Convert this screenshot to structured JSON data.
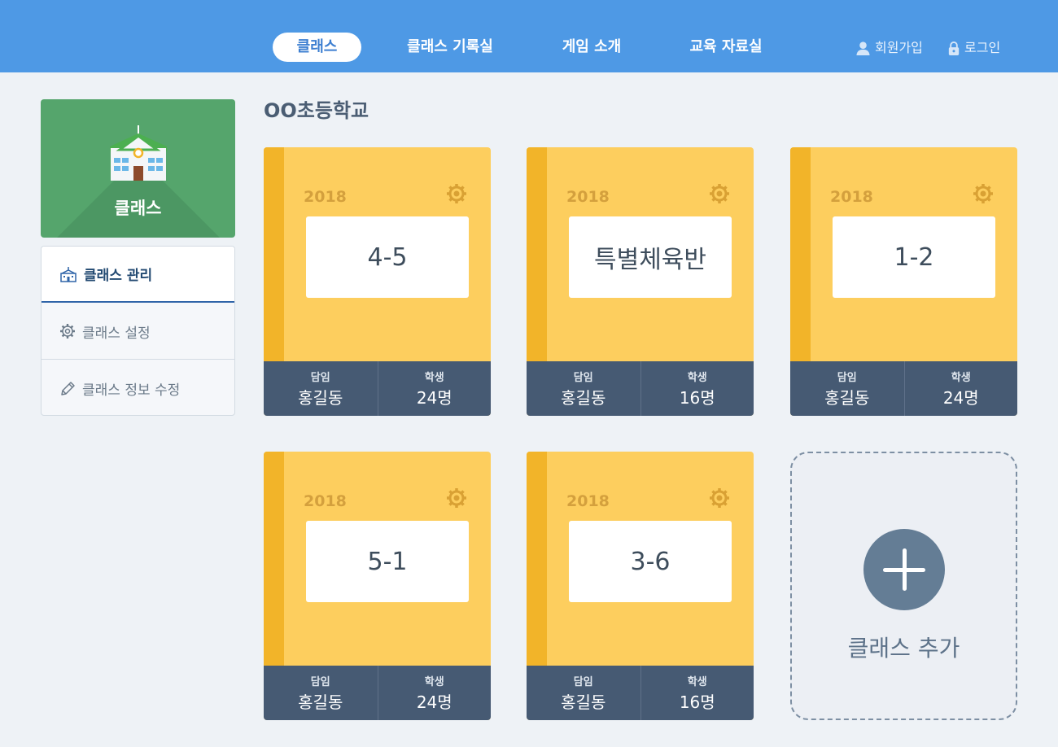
{
  "nav": {
    "tabs": [
      "클래스",
      "클래스 기록실",
      "게임 소개",
      "교육 자료실"
    ],
    "active_tab": "클래스",
    "signup": "회원가입",
    "login": "로그인"
  },
  "sidebar": {
    "title": "클래스",
    "items": [
      {
        "label": "클래스 관리",
        "icon": "school-outline-icon",
        "active": true
      },
      {
        "label": "클래스 설정",
        "icon": "gear-icon",
        "active": false
      },
      {
        "label": "클래스 정보 수정",
        "icon": "pencil-icon",
        "active": false
      }
    ]
  },
  "main": {
    "school_name": "OO초등학교",
    "teacher_label": "담임",
    "student_label": "학생",
    "classes": [
      {
        "year": "2018",
        "name": "4-5",
        "teacher": "홍길동",
        "students": "24명"
      },
      {
        "year": "2018",
        "name": "특별체육반",
        "teacher": "홍길동",
        "students": "16명"
      },
      {
        "year": "2018",
        "name": "1-2",
        "teacher": "홍길동",
        "students": "24명"
      },
      {
        "year": "2018",
        "name": "5-1",
        "teacher": "홍길동",
        "students": "24명"
      },
      {
        "year": "2018",
        "name": "3-6",
        "teacher": "홍길동",
        "students": "16명"
      }
    ],
    "add_class_label": "클래스 추가"
  },
  "colors": {
    "header": "#4e99e5",
    "card_yellow": "#fdce5e",
    "card_spine": "#f2b429",
    "card_footer": "#465a73",
    "sidebar_green": "#55a56c"
  }
}
